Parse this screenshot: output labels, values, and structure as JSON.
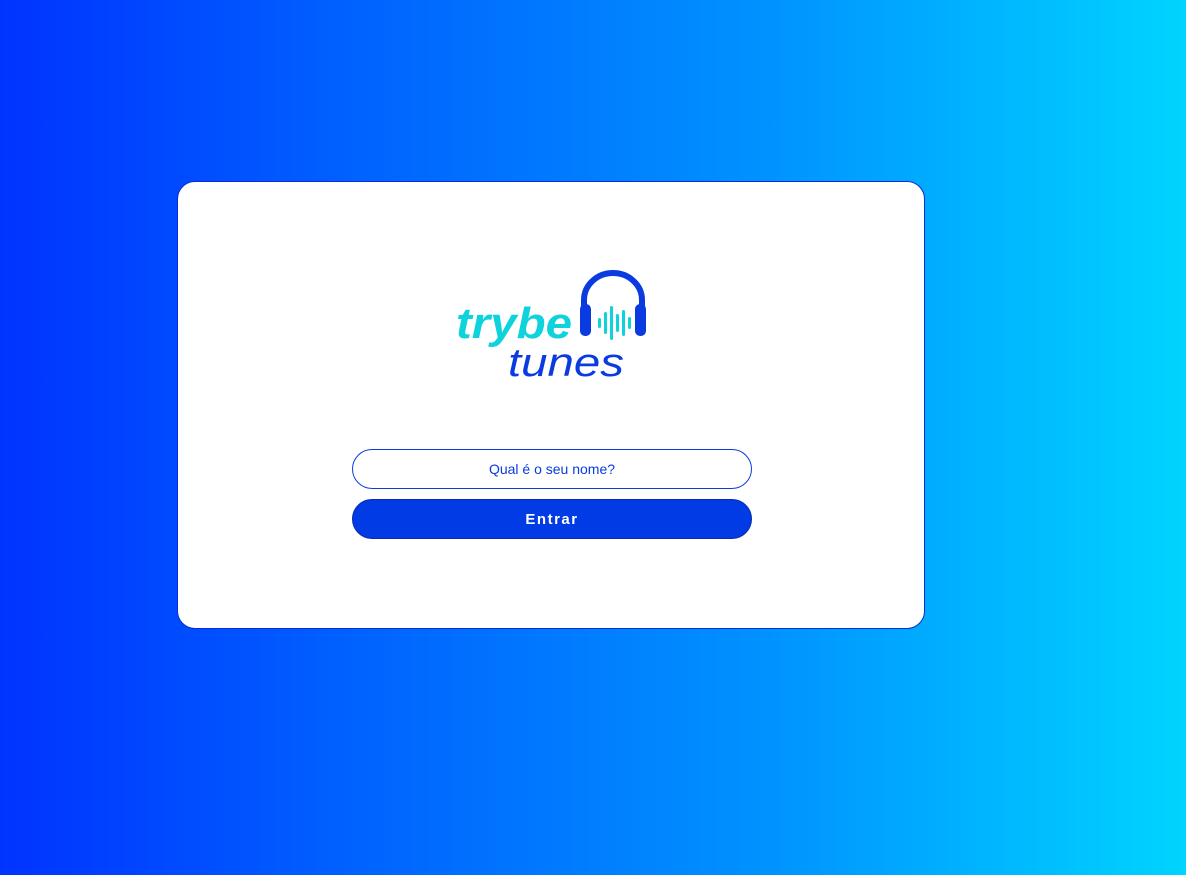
{
  "logo": {
    "word_top": "trybe",
    "word_bottom": "tunes",
    "icon": "headphones-icon",
    "colors": {
      "trybe": "#0fd3dc",
      "tunes": "#0a3be0",
      "headphones": "#0a3be0",
      "wave": "#0fd3dc"
    }
  },
  "login": {
    "name_placeholder": "Qual é o seu nome?",
    "name_value": "",
    "submit_label": "Entrar"
  },
  "colors": {
    "background_start": "#0033ff",
    "background_end": "#00d4ff",
    "accent": "#0a3be0",
    "button": "#003be5"
  }
}
